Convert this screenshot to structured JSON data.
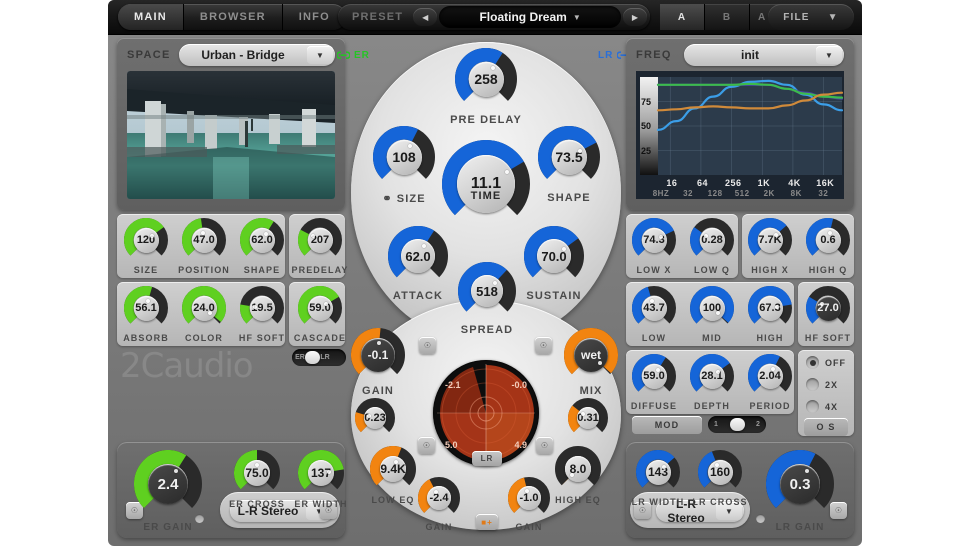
{
  "top": {
    "tabs": [
      {
        "label": "MAIN",
        "active": true
      },
      {
        "label": "BROWSER",
        "active": false
      },
      {
        "label": "INFO",
        "active": false
      }
    ],
    "preset_label": "PRESET",
    "preset_name": "Floating Dream",
    "prev_icon": "triangle-left-icon",
    "next_icon": "triangle-right-icon",
    "ab": [
      {
        "label": "A",
        "selected": true
      },
      {
        "label": "B",
        "selected": false
      },
      {
        "label": "A ◂▸ B",
        "selected": false
      }
    ],
    "file_label": "FILE",
    "file_caret": "▼"
  },
  "left": {
    "space_label": "SPACE",
    "space_value": "Urban - Bridge",
    "caret": "▼",
    "row1": [
      {
        "name": "SIZE",
        "value": "120",
        "pct": 0.7,
        "color": "green"
      },
      {
        "name": "POSITION",
        "value": "47.0",
        "pct": 0.47,
        "color": "green"
      },
      {
        "name": "SHAPE",
        "value": "62.0",
        "pct": 0.62,
        "color": "green"
      },
      {
        "name": "PREDELAY",
        "value": "207",
        "pct": 0.27,
        "color": "green"
      }
    ],
    "row2": [
      {
        "name": "ABSORB",
        "value": "56.1",
        "pct": 0.56,
        "color": "green"
      },
      {
        "name": "COLOR",
        "value": "24.0",
        "pct": 0.98,
        "color": "green"
      },
      {
        "name": "HF SOFT",
        "value": "19.5",
        "pct": 0.2,
        "color": "green"
      },
      {
        "name": "CASCADE",
        "value": "59.0",
        "pct": 0.72,
        "color": "green"
      }
    ],
    "erlr_toggle": {
      "left": "ER",
      "right": "LR",
      "state": "left"
    },
    "logo": "2Caudio"
  },
  "center": {
    "er_link": {
      "label": "ER",
      "icon": "link-icon",
      "color": "#25c425"
    },
    "lr_link": {
      "label": "LR",
      "icon": "link-icon",
      "color": "#2a6fd8"
    },
    "pre_delay": {
      "name": "PRE DELAY",
      "value": "258",
      "pct": 0.62
    },
    "size": {
      "name": "SIZE",
      "value": "108",
      "pct": 0.6,
      "icon": "link-icon"
    },
    "shape": {
      "name": "SHAPE",
      "value": "73.5",
      "pct": 0.73
    },
    "time": {
      "name": "TIME",
      "value": "11.1",
      "pct": 0.72
    },
    "attack": {
      "name": "ATTACK",
      "value": "62.0",
      "pct": 0.62
    },
    "sustain": {
      "name": "SUSTAIN",
      "value": "70.0",
      "pct": 0.7
    },
    "spread": {
      "name": "SPREAD",
      "value": "518",
      "pct": 0.66
    },
    "gain": {
      "name": "GAIN",
      "value": "-0.1",
      "pct": 0.52
    },
    "mix": {
      "name": "MIX",
      "value": "wet",
      "pct": 0.99
    },
    "gain_sub": {
      "value": "0.23",
      "pct": 0.23
    },
    "mix_sub": {
      "value": "0.31",
      "pct": 0.31
    },
    "low_eq": {
      "name": "LOW EQ",
      "value": "9.4K",
      "pct": 0.58
    },
    "high_eq": {
      "name": "HIGH EQ",
      "value": "8.0",
      "pct": 0.0
    },
    "low_gain": {
      "name": "GAIN",
      "value": "-2.4",
      "pct": 0.4
    },
    "high_gain": {
      "name": "GAIN",
      "value": "-1.0",
      "pct": 0.45
    },
    "lr_button": "LR",
    "lock_icon": "lock-icon",
    "radar": {
      "top_left": "-2.1",
      "top_right": "-0.0",
      "bottom_left": "5.0",
      "bottom_right": "4.9"
    }
  },
  "right": {
    "freq_label": "FREQ",
    "freq_value": "init",
    "caret": "▼",
    "row1": [
      {
        "name": "LOW X",
        "value": "74.3",
        "pct": 0.74
      },
      {
        "name": "LOW Q",
        "value": "0.28",
        "pct": 0.3
      },
      {
        "name": "HIGH X",
        "value": "7.7K",
        "pct": 0.68
      },
      {
        "name": "HIGH Q",
        "value": "0.6",
        "pct": 0.55
      }
    ],
    "row2": [
      {
        "name": "LOW",
        "value": "43.7",
        "pct": 0.44
      },
      {
        "name": "MID",
        "value": "100",
        "pct": 0.99
      },
      {
        "name": "HIGH",
        "value": "67.3",
        "pct": 0.8
      },
      {
        "name": "HF SOFT",
        "value": "27.0",
        "pct": 0.28,
        "dark": true
      }
    ],
    "row3": [
      {
        "name": "DIFFUSE",
        "value": "59.0",
        "pct": 0.62
      },
      {
        "name": "DEPTH",
        "value": "28.1",
        "pct": 0.7
      },
      {
        "name": "PERIOD",
        "value": "2.04",
        "pct": 0.6
      }
    ],
    "mod": {
      "label": "MOD",
      "left": "1",
      "right": "2",
      "state": "right"
    },
    "os_options": [
      {
        "label": "OFF",
        "selected": true
      },
      {
        "label": "2X",
        "selected": false
      },
      {
        "label": "4X",
        "selected": false
      }
    ],
    "os_label": "O S"
  },
  "bottom_left": {
    "er_gain": {
      "name": "ER GAIN",
      "value": "2.4",
      "pct": 0.62
    },
    "er_cross": {
      "name": "ER CROSS",
      "value": "75.0",
      "pct": 0.5
    },
    "er_width": {
      "name": "ER WIDTH",
      "value": "137",
      "pct": 0.8
    },
    "routing": "L-R Stereo",
    "caret": "▼",
    "lock_icon": "lock-icon"
  },
  "bottom_right": {
    "lr_width": {
      "name": "LR WIDTH",
      "value": "143",
      "pct": 0.68
    },
    "lr_cross": {
      "name": "LR CROSS",
      "value": "160",
      "pct": 0.42
    },
    "lr_gain": {
      "name": "LR GAIN",
      "value": "0.3",
      "pct": 0.6
    },
    "routing": "L-R Stereo",
    "caret": "▼",
    "lock_icon": "lock-icon"
  },
  "chart_data": {
    "type": "line",
    "title": "",
    "xlabel": "",
    "ylabel": "",
    "x_ticks": [
      "16",
      "64",
      "256",
      "1K",
      "4K",
      "16K"
    ],
    "x_subticks": [
      "8HZ",
      "32",
      "128",
      "512",
      "2K",
      "8K",
      "32"
    ],
    "y_ticks": [
      "75",
      "50",
      "25"
    ],
    "ylim": [
      0,
      100
    ],
    "series": [
      {
        "name": "blue",
        "color": "#3b9ee8",
        "values": [
          46,
          55,
          68,
          80,
          90,
          95,
          96,
          92,
          82,
          72,
          66
        ]
      },
      {
        "name": "purple",
        "color": "#4a3fa8",
        "values": [
          92,
          92,
          92,
          92,
          92,
          92,
          92,
          88,
          84,
          80,
          78
        ]
      },
      {
        "name": "green",
        "color": "#3cbb4c",
        "values": [
          92,
          92,
          92,
          92,
          92,
          93,
          92,
          88,
          83,
          80,
          79
        ]
      },
      {
        "name": "orange",
        "color": "#d08a3a",
        "values": [
          66,
          67,
          69,
          70,
          69,
          68,
          68,
          71,
          76,
          82,
          84
        ]
      }
    ],
    "grid": true,
    "legend": "none"
  },
  "colors": {
    "green": "#5fd020",
    "blue": "#1565d8",
    "orange": "#f28410",
    "track": "#2a2a2a",
    "panel": "#c5c5c5"
  }
}
